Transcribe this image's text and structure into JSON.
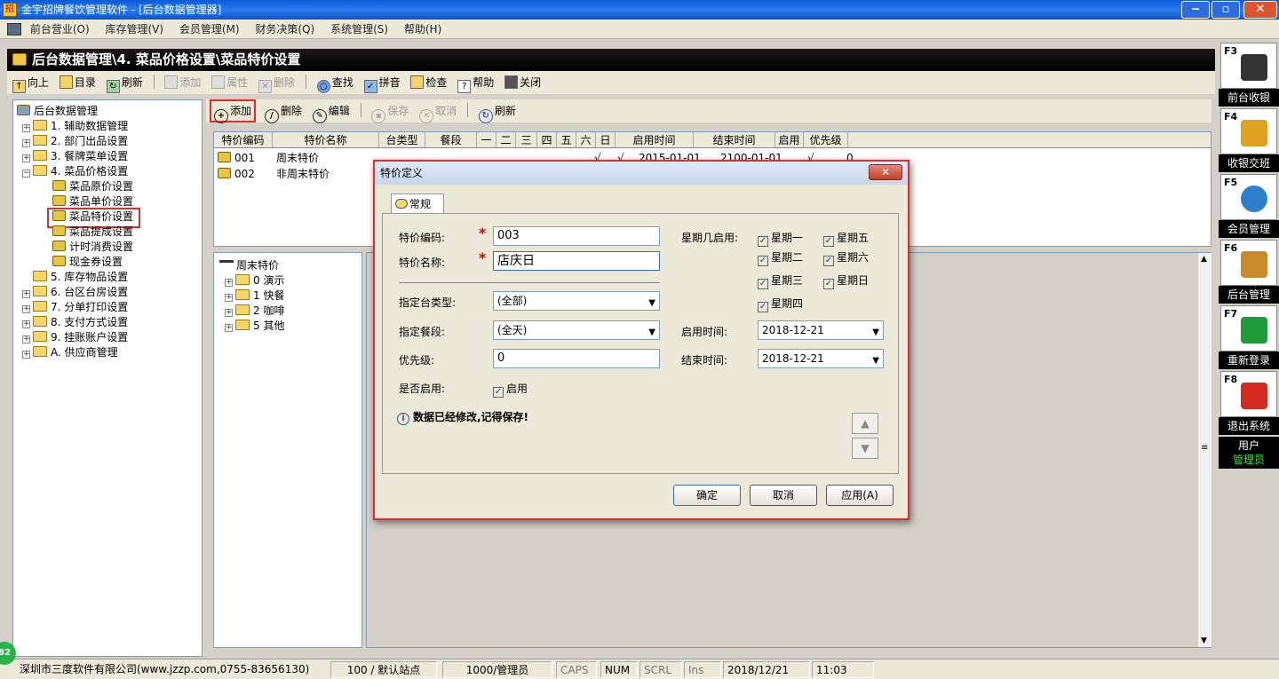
{
  "window": {
    "title": "金宇招牌餐饮管理软件 - [后台数据管理器]",
    "min": "‒",
    "max": "▫",
    "close": "✕"
  },
  "menu": [
    "前台营业(O)",
    "库存管理(V)",
    "会员管理(M)",
    "财务决策(Q)",
    "系统管理(S)",
    "帮助(H)"
  ],
  "page_title": "后台数据管理\\4. 菜品价格设置\\菜品特价设置",
  "toolbar": {
    "up": "向上",
    "catalog": "目录",
    "refresh": "刷新",
    "add": "添加",
    "props": "属性",
    "delete": "删除",
    "find": "查找",
    "pinyin": "拼音",
    "check": "检查",
    "help": "帮助",
    "close": "关闭"
  },
  "tree": {
    "root": "后台数据管理",
    "items": [
      "1. 辅助数据管理",
      "2. 部门出品设置",
      "3. 餐牌菜单设置",
      "4. 菜品价格设置",
      "5. 库存物品设置",
      "6. 台区台房设置",
      "7. 分单打印设置",
      "8. 支付方式设置",
      "9. 挂账账户设置",
      "A. 供应商管理"
    ],
    "sub": [
      "菜品原价设置",
      "菜品单价设置",
      "菜品特价设置",
      "菜品提成设置",
      "计时消费设置",
      "现金券设置"
    ]
  },
  "subtoolbar": {
    "add": "添加",
    "delete": "删除",
    "edit": "编辑",
    "save": "保存",
    "cancel": "取消",
    "refresh": "刷新"
  },
  "grid": {
    "headers": [
      "特价编码",
      "特价名称",
      "台类型",
      "餐段",
      "一",
      "二",
      "三",
      "四",
      "五",
      "六",
      "日",
      "启用时间",
      "结束时间",
      "启用",
      "优先级"
    ],
    "rows": [
      {
        "code": "001",
        "name": "周末特价",
        "sat": "√",
        "sun": "√",
        "start": "2015-01-01",
        "end": "2100-01-01",
        "enabled": "√",
        "priority": "0"
      },
      {
        "code": "002",
        "name": "非周末特价"
      }
    ]
  },
  "tree2": {
    "root": "周末特价",
    "items": [
      "0 演示",
      "1 快餐",
      "2 咖啡",
      "5 其他"
    ]
  },
  "fkeys": [
    {
      "key": "F3",
      "label": "前台收银",
      "icon": "cashier-icon",
      "color": "#2a2a2a"
    },
    {
      "key": "F4",
      "label": "收银交班",
      "icon": "clipboard-check-icon",
      "color": "#e0a020"
    },
    {
      "key": "F5",
      "label": "会员管理",
      "icon": "members-icon",
      "color": "#2f7fcf"
    },
    {
      "key": "F6",
      "label": "后台管理",
      "icon": "tools-icon",
      "color": "#c98a2a"
    },
    {
      "key": "F7",
      "label": "重新登录",
      "icon": "hourglass-icon",
      "color": "#1e9c3c"
    },
    {
      "key": "F8",
      "label": "退出系统",
      "icon": "power-icon",
      "color": "#d52a20"
    }
  ],
  "user": {
    "label": "用户",
    "name": "管理员"
  },
  "status": {
    "badge": "82",
    "company": "深圳市三度软件有限公司(www.jzzp.com,0755-83656130)",
    "station": "100 / 默认站点",
    "operator": "1000/管理员",
    "caps": "CAPS",
    "num": "NUM",
    "scrl": "SCRL",
    "ins": "Ins",
    "date": "2018/12/21",
    "time": "11:03"
  },
  "dialog": {
    "title": "特价定义",
    "tab": "常规",
    "code_label": "特价编码:",
    "code_value": "003",
    "name_label": "特价名称:",
    "name_value": "店庆日",
    "table_type_label": "指定台类型:",
    "table_type_value": "(全部)",
    "period_label": "指定餐段:",
    "period_value": "(全天)",
    "priority_label": "优先级:",
    "priority_value": "0",
    "enabled_label": "是否启用:",
    "enabled_cb": "启用",
    "weekday_label": "星期几启用:",
    "weekdays": [
      "星期一",
      "星期五",
      "星期二",
      "星期六",
      "星期三",
      "星期日",
      "星期四"
    ],
    "start_label": "启用时间:",
    "start_value": "2018-12-21",
    "end_label": "结束时间:",
    "end_value": "2018-12-21",
    "info": "数据已经修改,记得保存!",
    "ok": "确定",
    "cancel": "取消",
    "apply": "应用(A)"
  }
}
